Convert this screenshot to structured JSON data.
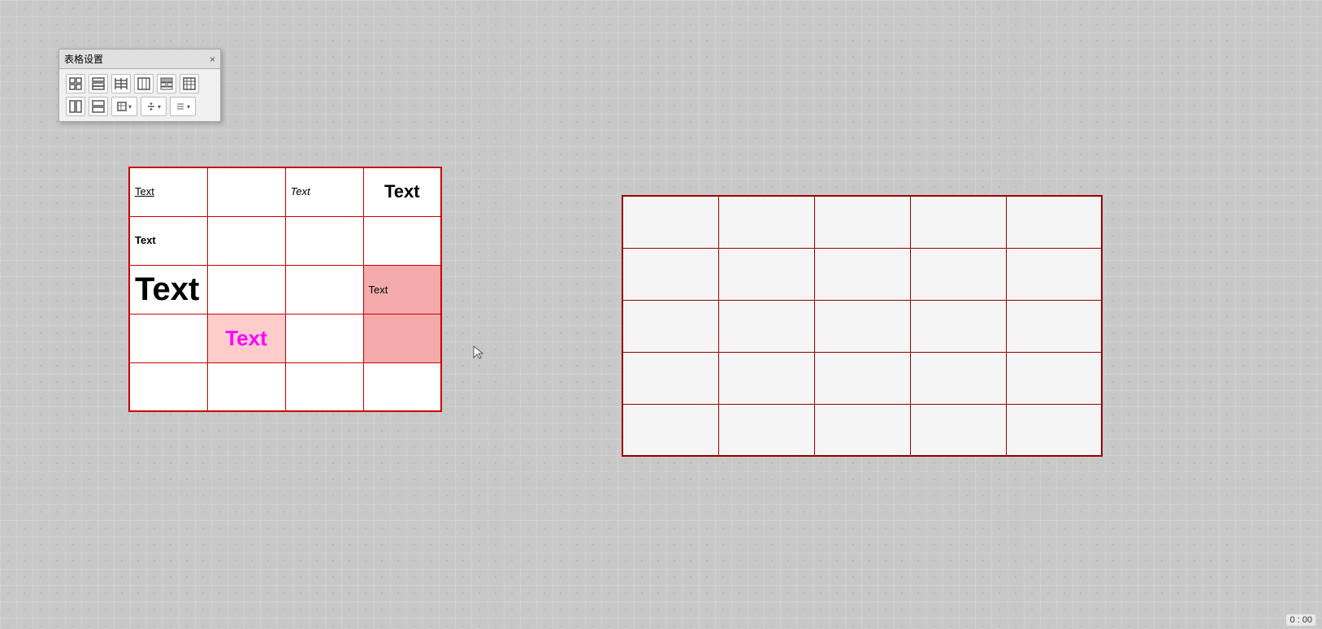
{
  "toolbar": {
    "title": "表格设置",
    "close_label": "×",
    "buttons_row1": [
      {
        "icon": "⊞",
        "name": "table-style-1"
      },
      {
        "icon": "⊟",
        "name": "table-style-2"
      },
      {
        "icon": "⊠",
        "name": "table-style-3"
      },
      {
        "icon": "⊡",
        "name": "table-style-4"
      },
      {
        "icon": "⋮⋮",
        "name": "table-style-5"
      },
      {
        "icon": "⋯",
        "name": "table-style-6"
      }
    ],
    "buttons_row2": [
      {
        "icon": "⊞",
        "name": "table-style-7"
      },
      {
        "icon": "⊟",
        "name": "table-style-8"
      },
      {
        "icon": "⊡▾",
        "name": "table-border-dropdown"
      },
      {
        "icon": "≑▾",
        "name": "table-align-v-dropdown"
      },
      {
        "icon": "≡▾",
        "name": "table-align-h-dropdown"
      }
    ]
  },
  "table_left": {
    "cells": [
      {
        "row": 0,
        "col": 0,
        "text": "Text",
        "style": "underline"
      },
      {
        "row": 0,
        "col": 1,
        "text": ""
      },
      {
        "row": 0,
        "col": 2,
        "text": "Text",
        "style": "italic"
      },
      {
        "row": 0,
        "col": 3,
        "text": "Text",
        "style": "large"
      },
      {
        "row": 1,
        "col": 0,
        "text": "Text",
        "style": "bold-label"
      },
      {
        "row": 2,
        "col": 0,
        "text": "Text",
        "style": "big"
      },
      {
        "row": 2,
        "col": 3,
        "text": "Text",
        "style": "pink"
      },
      {
        "row": 3,
        "col": 1,
        "text": "Text",
        "style": "magenta"
      }
    ]
  },
  "table_right": {
    "rows": 5,
    "cols": 5
  },
  "timer": {
    "label": "0 : 00"
  }
}
